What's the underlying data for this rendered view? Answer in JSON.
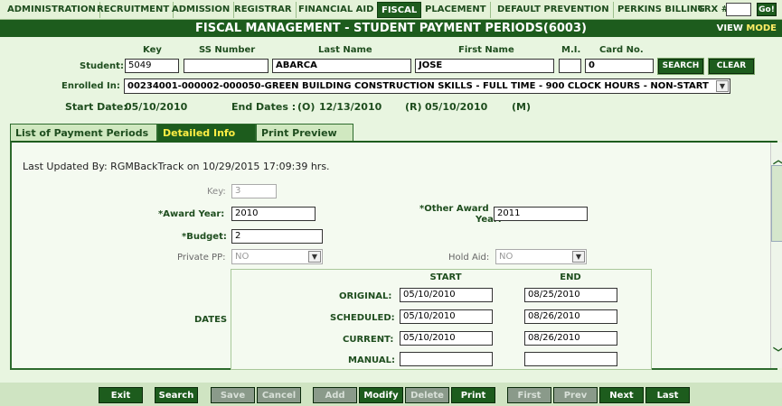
{
  "nav": {
    "items": [
      "ADMINISTRATION",
      "RECRUITMENT",
      "ADMISSION",
      "REGISTRAR",
      "FINANCIAL AID",
      "FISCAL",
      "PLACEMENT",
      "DEFAULT PREVENTION",
      "PERKINS BILLING"
    ],
    "active": "FISCAL",
    "trx_label": "TRX #:",
    "trx_value": "",
    "go_label": "Go!"
  },
  "title": "FISCAL MANAGEMENT - STUDENT PAYMENT PERIODS(6003)",
  "view_label": "VIEW",
  "mode_label": "MODE",
  "student": {
    "label": "Student:",
    "col_key": "Key",
    "col_ssn": "SS Number",
    "col_last": "Last Name",
    "col_first": "First Name",
    "col_mi": "M.I.",
    "col_card": "Card No.",
    "key": "5049",
    "ssn": "",
    "last": "ABARCA",
    "first": "JOSE",
    "mi": "",
    "card": "0",
    "search_label": "SEARCH",
    "clear_label": "CLEAR"
  },
  "enrolled": {
    "label": "Enrolled In:",
    "value": "00234001-000002-000050-GREEN BUILDING CONSTRUCTION SKILLS - FULL TIME - 900 CLOCK HOURS - NON-START"
  },
  "dates_line": {
    "start_label": "Start Date:",
    "start_value": "05/10/2010",
    "end_label": "End Dates :",
    "o_label": "(O)",
    "o_value": "12/13/2010",
    "r_label": "(R)",
    "r_value": "05/10/2010",
    "m_label": "(M)"
  },
  "tabs": [
    "List of Payment Periods",
    "Detailed Info",
    "Print Preview"
  ],
  "active_tab": "Detailed Info",
  "detail": {
    "last_updated": "Last Updated By: RGMBackTrack on 10/29/2015 17:09:39 hrs.",
    "key_label": "Key:",
    "key_value": "3",
    "award_year_label": "*Award Year:",
    "award_year_value": "2010",
    "other_award_label_1": "*Other Award",
    "other_award_label_2": "Year:",
    "other_award_value": "2011",
    "budget_label": "*Budget:",
    "budget_value": "2",
    "private_pp_label": "Private PP:",
    "private_pp_value": "NO",
    "hold_aid_label": "Hold Aid:",
    "hold_aid_value": "NO"
  },
  "dates_table": {
    "section_label": "DATES",
    "start_header": "START",
    "end_header": "END",
    "rows": [
      {
        "label": "ORIGINAL:",
        "start": "05/10/2010",
        "end": "08/25/2010"
      },
      {
        "label": "SCHEDULED:",
        "start": "05/10/2010",
        "end": "08/26/2010"
      },
      {
        "label": "CURRENT:",
        "start": "05/10/2010",
        "end": "08/26/2010"
      },
      {
        "label": "MANUAL:",
        "start": "",
        "end": ""
      }
    ]
  },
  "buttons": {
    "exit": "Exit",
    "search": "Search",
    "save": "Save",
    "cancel": "Cancel",
    "add": "Add",
    "modify": "Modify",
    "delete": "Delete",
    "print": "Print",
    "first": "First",
    "prev": "Prev",
    "next": "Next",
    "last": "Last"
  }
}
